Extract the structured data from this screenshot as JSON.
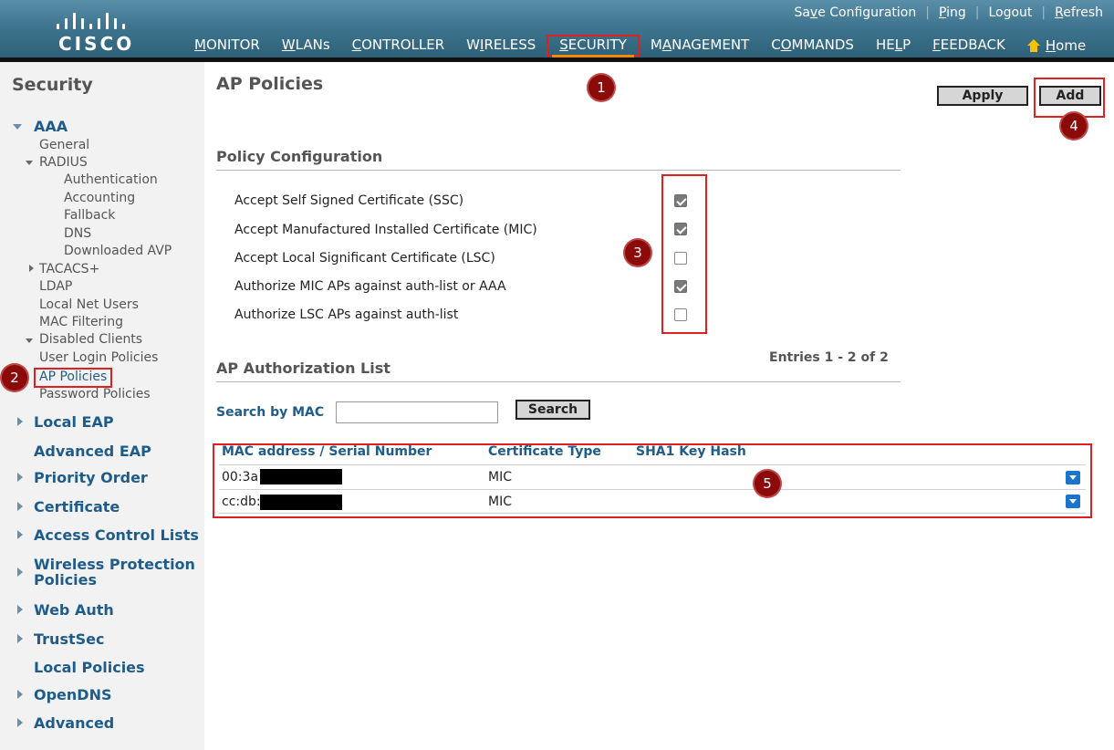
{
  "header": {
    "logo_text": "CISCO",
    "top_links": [
      {
        "id": "save",
        "pre": "Sa",
        "u": "v",
        "post": "e Configuration"
      },
      {
        "id": "ping",
        "pre": "",
        "u": "P",
        "post": "ing"
      },
      {
        "id": "logout",
        "pre": "Logout",
        "u": "",
        "post": ""
      },
      {
        "id": "refresh",
        "pre": "",
        "u": "R",
        "post": "efresh"
      }
    ],
    "nav": [
      {
        "pre": "",
        "u": "M",
        "post": "ONITOR"
      },
      {
        "pre": "",
        "u": "W",
        "post": "LANs"
      },
      {
        "pre": "",
        "u": "C",
        "post": "ONTROLLER"
      },
      {
        "pre": "W",
        "u": "I",
        "post": "RELESS"
      },
      {
        "pre": "",
        "u": "S",
        "post": "ECURITY"
      },
      {
        "pre": "M",
        "u": "A",
        "post": "NAGEMENT"
      },
      {
        "pre": "C",
        "u": "O",
        "post": "MMANDS"
      },
      {
        "pre": "HE",
        "u": "L",
        "post": "P"
      },
      {
        "pre": "",
        "u": "F",
        "post": "EEDBACK"
      }
    ],
    "home": {
      "pre": "",
      "u": "H",
      "post": "ome"
    }
  },
  "sidebar": {
    "title": "Security",
    "aaa": "AAA",
    "general": "General",
    "radius": "RADIUS",
    "authentication": "Authentication",
    "accounting": "Accounting",
    "fallback": "Fallback",
    "dns": "DNS",
    "downloaded_avp": "Downloaded AVP",
    "tacacs": "TACACS+",
    "ldap": "LDAP",
    "local_net_users": "Local Net Users",
    "mac_filtering": "MAC Filtering",
    "disabled_clients": "Disabled Clients",
    "user_login_policies": "User Login Policies",
    "ap_policies": "AP Policies",
    "password_policies": "Password Policies",
    "local_eap": "Local EAP",
    "advanced_eap": "Advanced EAP",
    "priority_order": "Priority Order",
    "certificate": "Certificate",
    "acl": "Access Control Lists",
    "wpp_line1": "Wireless Protection",
    "wpp_line2": "Policies",
    "web_auth": "Web Auth",
    "trustsec": "TrustSec",
    "local_policies": "Local Policies",
    "opendns": "OpenDNS",
    "advanced": "Advanced"
  },
  "markers": [
    "1",
    "2",
    "3",
    "4",
    "5"
  ],
  "main": {
    "title": "AP Policies",
    "apply_label": "Apply",
    "add_label": "Add",
    "policy_section": "Policy Configuration",
    "policies": [
      {
        "label": "Accept Self Signed Certificate (SSC)",
        "checked": true
      },
      {
        "label": "Accept Manufactured Installed Certificate (MIC)",
        "checked": true
      },
      {
        "label": "Accept Local Significant Certificate (LSC)",
        "checked": false
      },
      {
        "label": "Authorize MIC APs against auth-list or AAA",
        "checked": true
      },
      {
        "label": "Authorize LSC APs against auth-list",
        "checked": false
      }
    ],
    "auth_section": "AP Authorization List",
    "entries": "Entries 1 - 2 of 2",
    "search_label": "Search by MAC",
    "search_value": "",
    "search_button": "Search",
    "table": {
      "headers": [
        "MAC address / Serial Number",
        "Certificate Type",
        "SHA1 Key Hash"
      ],
      "rows": [
        {
          "mac": "00:3a",
          "cert_type": "MIC",
          "sha1": ""
        },
        {
          "mac": "cc:db:",
          "cert_type": "MIC",
          "sha1": ""
        }
      ]
    }
  }
}
